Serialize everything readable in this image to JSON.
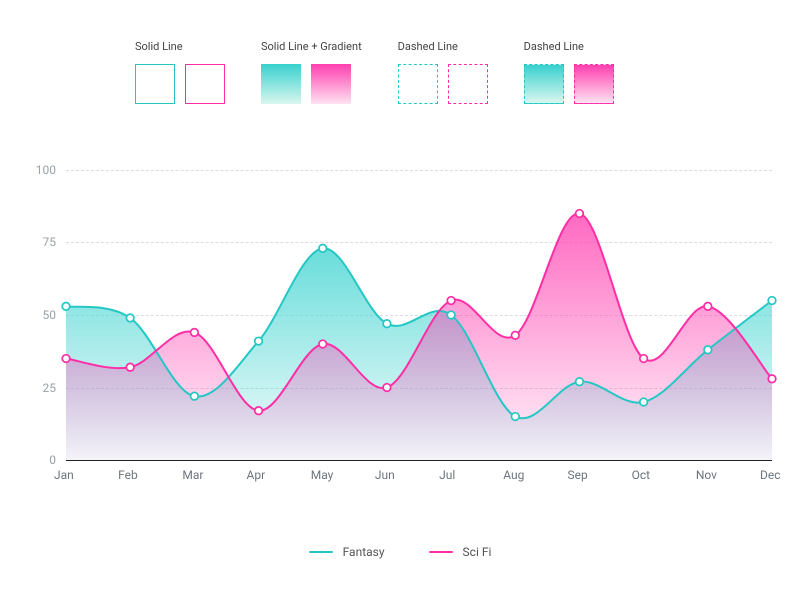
{
  "swatch_groups": [
    {
      "label": "Solid Line"
    },
    {
      "label": "Solid Line + Gradient"
    },
    {
      "label": "Dashed Line"
    },
    {
      "label": "Dashed Line"
    }
  ],
  "yticks": [
    "0",
    "25",
    "50",
    "75",
    "100"
  ],
  "xlabels": [
    "Jan",
    "Feb",
    "Mar",
    "Apr",
    "May",
    "Jun",
    "Jul",
    "Aug",
    "Sep",
    "Oct",
    "Nov",
    "Dec"
  ],
  "legend": {
    "a": "Fantasy",
    "b": "Sci Fi"
  },
  "colors": {
    "a": "#25c7c4",
    "b": "#ff2ea6"
  },
  "chart_data": {
    "type": "area",
    "categories": [
      "Jan",
      "Feb",
      "Mar",
      "Apr",
      "May",
      "Jun",
      "Jul",
      "Aug",
      "Sep",
      "Oct",
      "Nov",
      "Dec"
    ],
    "series": [
      {
        "name": "Fantasy",
        "values": [
          53,
          49,
          22,
          41,
          73,
          47,
          50,
          15,
          27,
          20,
          38,
          55
        ]
      },
      {
        "name": "Sci Fi",
        "values": [
          35,
          32,
          44,
          17,
          40,
          25,
          55,
          43,
          85,
          35,
          53,
          28
        ]
      }
    ],
    "ylim": [
      0,
      100
    ],
    "xlabel": "",
    "ylabel": "",
    "title": "",
    "grid": "dashed-horizontal",
    "legend_position": "bottom"
  }
}
